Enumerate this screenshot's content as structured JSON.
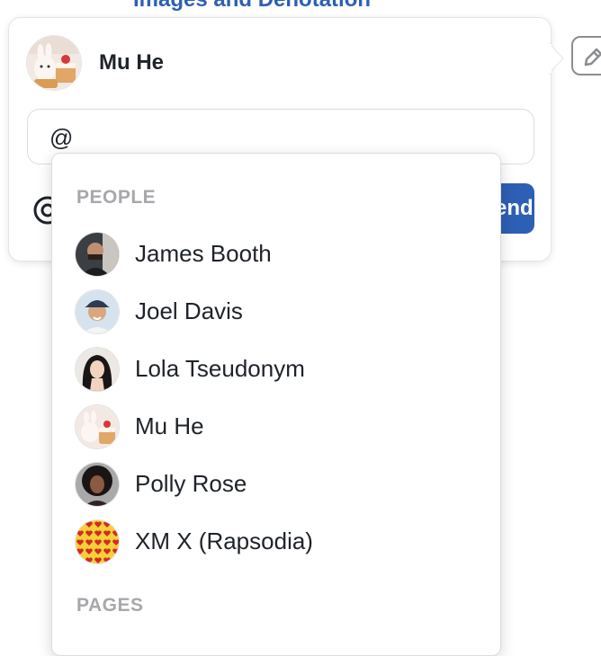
{
  "page": {
    "heading_fragment": "Images and Denotation"
  },
  "comment": {
    "author_name": "Mu He",
    "input_value": "@",
    "send_label": "Send"
  },
  "mention_menu": {
    "people_label": "PEOPLE",
    "pages_label": "PAGES",
    "people": [
      {
        "name": "James Booth",
        "avatar": "dark-photo-avatar"
      },
      {
        "name": "Joel Davis",
        "avatar": "cap-photo-avatar"
      },
      {
        "name": "Lola Tseudonym",
        "avatar": "dark-hair-photo-avatar"
      },
      {
        "name": "Mu He",
        "avatar": "cake-bunny-avatar"
      },
      {
        "name": "Polly Rose",
        "avatar": "curly-hair-photo-avatar"
      },
      {
        "name": "XM X (Rapsodia)",
        "avatar": "hearts-pattern-avatar"
      }
    ]
  },
  "colors": {
    "accent": "#2d5fb5",
    "section_label": "#a6a8ab",
    "border": "#dcdde0"
  }
}
